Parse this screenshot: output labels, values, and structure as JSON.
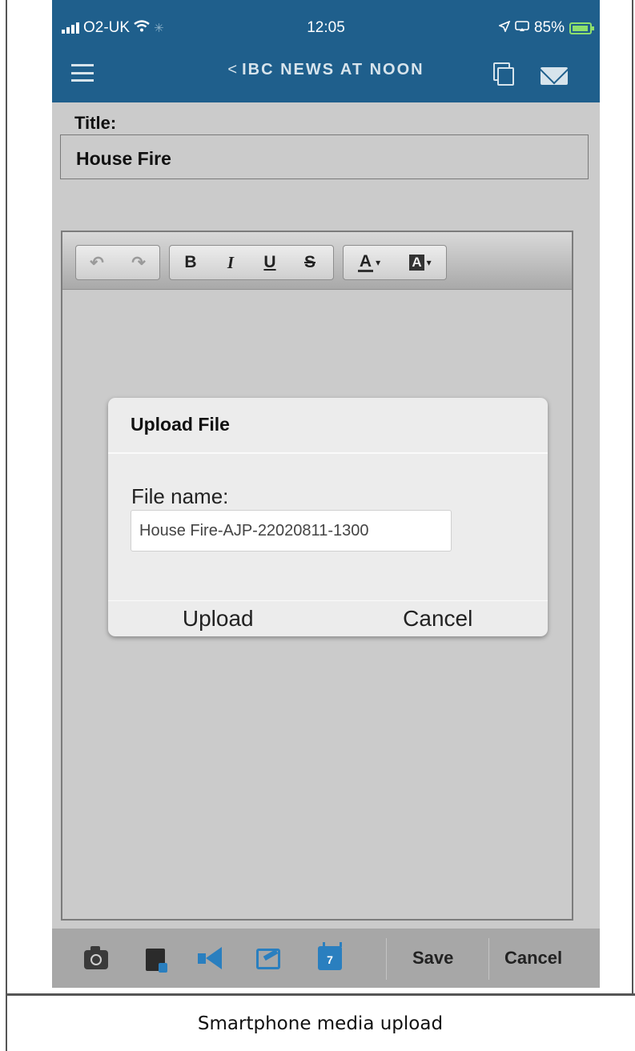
{
  "status_bar": {
    "carrier": "O2-UK",
    "time": "12:05",
    "battery": "85%",
    "battery_level": 0.85
  },
  "nav": {
    "back_chevron": "<",
    "title": "IBC NEWS AT NOON",
    "icons": [
      "menu-icon",
      "copy-icon",
      "mail-icon"
    ]
  },
  "form": {
    "title_label": "Title:",
    "title_value": "House Fire"
  },
  "editor_toolbar": {
    "undo": "↶",
    "redo": "↷",
    "bold": "B",
    "italic": "I",
    "underline": "U",
    "strikethrough": "S",
    "font_color": "A",
    "highlight_color": "A"
  },
  "dialog": {
    "title": "Upload File",
    "field_label": "File name:",
    "file_name": "House Fire-AJP-22020811-1300",
    "upload": "Upload",
    "cancel": "Cancel"
  },
  "bottom_bar": {
    "icons": [
      "camera-icon",
      "document-icon",
      "megaphone-icon",
      "edit-icon",
      "calendar-icon"
    ],
    "calendar_day": "7",
    "save": "Save",
    "cancel": "Cancel"
  },
  "caption": "Smartphone media upload",
  "colors": {
    "header_blue": "#1f5f8c",
    "screen_gray": "#cbcbcb",
    "icon_blue": "#2a7fbf",
    "battery_green": "#8fe06c"
  }
}
